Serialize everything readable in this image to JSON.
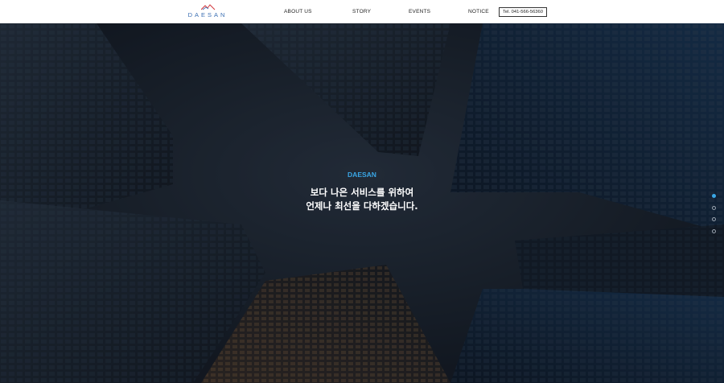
{
  "header": {
    "logo_text": "DAESAN",
    "nav": [
      "ABOUT US",
      "STORY",
      "EVENTS",
      "NOTICE"
    ],
    "tel": "Tel. 041-566-56360"
  },
  "hero": {
    "kicker": "DAESAN",
    "line1": "보다 나은 서비스를 위하여",
    "line2": "언제나 최선을 다하겠습니다."
  },
  "slides": {
    "count": 4,
    "active_index": 0
  },
  "colors": {
    "accent": "#3aa7e6",
    "logo": "#3b6fb3"
  }
}
